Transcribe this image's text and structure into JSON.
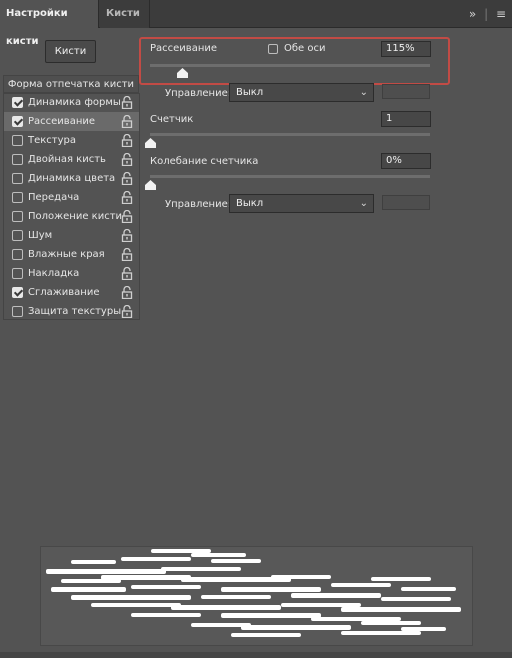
{
  "tabs": [
    {
      "label": "Настройки кисти",
      "active": true
    },
    {
      "label": "Кисти",
      "active": false
    }
  ],
  "header_icons": [
    "collapse-icon",
    "panel-menu-icon"
  ],
  "header_glyphs": {
    "collapse": "»",
    "menu": "≡"
  },
  "brushes_button": "Кисти",
  "brush_tip_shape": "Форма отпечатка кисти",
  "options": [
    {
      "label": "Динамика формы",
      "checked": true,
      "selected": false
    },
    {
      "label": "Рассеивание",
      "checked": true,
      "selected": true
    },
    {
      "label": "Текстура",
      "checked": false,
      "selected": false
    },
    {
      "label": "Двойная кисть",
      "checked": false,
      "selected": false
    },
    {
      "label": "Динамика цвета",
      "checked": false,
      "selected": false
    },
    {
      "label": "Передача",
      "checked": false,
      "selected": false
    },
    {
      "label": "Положение кисти",
      "checked": false,
      "selected": false
    },
    {
      "label": "Шум",
      "checked": false,
      "selected": false
    },
    {
      "label": "Влажные края",
      "checked": false,
      "selected": false
    },
    {
      "label": "Накладка",
      "checked": false,
      "selected": false
    },
    {
      "label": "Сглаживание",
      "checked": true,
      "selected": false
    },
    {
      "label": "Защита текстуры",
      "checked": false,
      "selected": false
    }
  ],
  "scatter": {
    "label": "Рассеивание",
    "both_axes_label": "Обе оси",
    "both_axes_checked": false,
    "value": "115%",
    "slider_fraction": 0.115
  },
  "control1": {
    "label": "Управление:",
    "value": "Выкл"
  },
  "count": {
    "label": "Счетчик",
    "value": "1",
    "slider_fraction": 0.0
  },
  "count_jitter": {
    "label": "Колебание счетчика",
    "value": "0%",
    "slider_fraction": 0.0
  },
  "control2": {
    "label": "Управление:",
    "value": "Выкл"
  },
  "colors": {
    "highlight": "#c24b45",
    "selected_row": "#6a6a6a",
    "panel": "#535353"
  }
}
